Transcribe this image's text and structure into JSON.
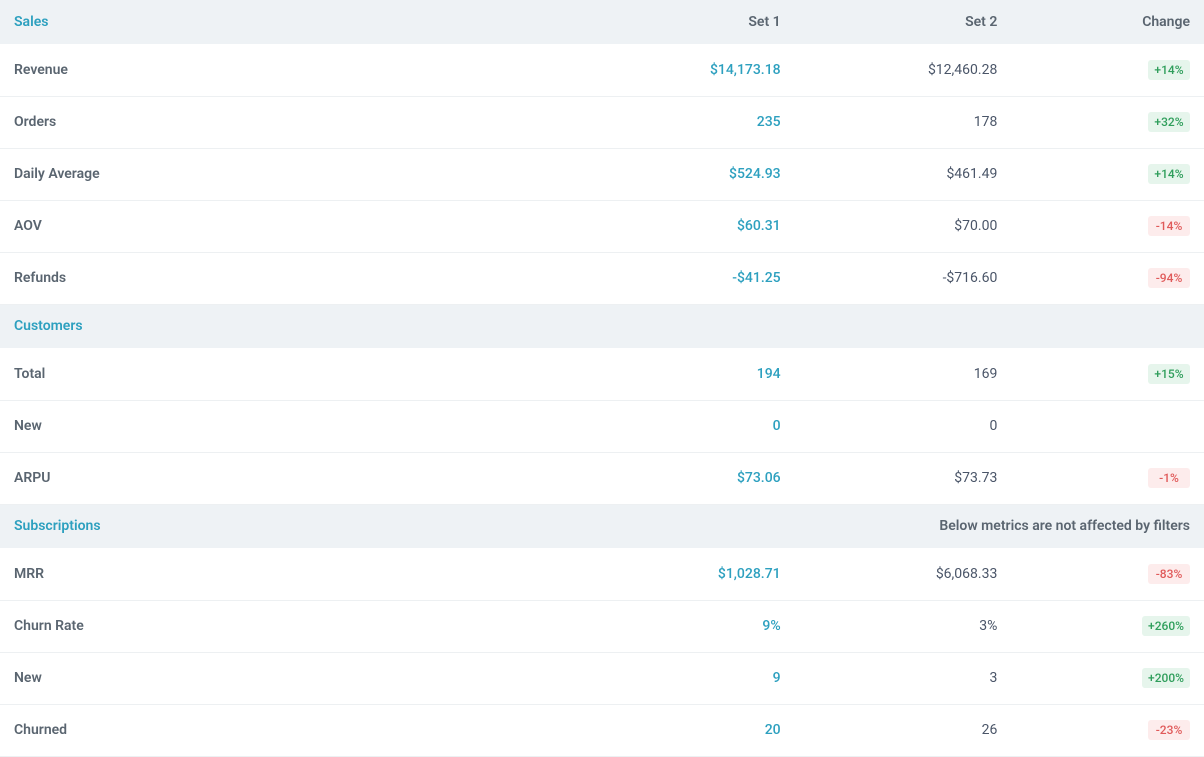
{
  "columns": {
    "set1": "Set 1",
    "set2": "Set 2",
    "change": "Change"
  },
  "sections": {
    "sales": {
      "title": "Sales",
      "rows": {
        "revenue": {
          "label": "Revenue",
          "set1": "$14,173.18",
          "set2": "$12,460.28",
          "change": "+14%",
          "dir": "pos"
        },
        "orders": {
          "label": "Orders",
          "set1": "235",
          "set2": "178",
          "change": "+32%",
          "dir": "pos"
        },
        "daily_avg": {
          "label": "Daily Average",
          "set1": "$524.93",
          "set2": "$461.49",
          "change": "+14%",
          "dir": "pos"
        },
        "aov": {
          "label": "AOV",
          "set1": "$60.31",
          "set2": "$70.00",
          "change": "-14%",
          "dir": "neg"
        },
        "refunds": {
          "label": "Refunds",
          "set1": "-$41.25",
          "set2": "-$716.60",
          "change": "-94%",
          "dir": "neg"
        }
      }
    },
    "customers": {
      "title": "Customers",
      "rows": {
        "total": {
          "label": "Total",
          "set1": "194",
          "set2": "169",
          "change": "+15%",
          "dir": "pos"
        },
        "new": {
          "label": "New",
          "set1": "0",
          "set2": "0",
          "change": "",
          "dir": ""
        },
        "arpu": {
          "label": "ARPU",
          "set1": "$73.06",
          "set2": "$73.73",
          "change": "-1%",
          "dir": "neg"
        }
      }
    },
    "subscriptions": {
      "title": "Subscriptions",
      "note": "Below metrics are not affected by filters",
      "rows": {
        "mrr": {
          "label": "MRR",
          "set1": "$1,028.71",
          "set2": "$6,068.33",
          "change": "-83%",
          "dir": "neg"
        },
        "churn_rate": {
          "label": "Churn Rate",
          "set1": "9%",
          "set2": "3%",
          "change": "+260%",
          "dir": "pos"
        },
        "new": {
          "label": "New",
          "set1": "9",
          "set2": "3",
          "change": "+200%",
          "dir": "pos"
        },
        "churned": {
          "label": "Churned",
          "set1": "20",
          "set2": "26",
          "change": "-23%",
          "dir": "neg"
        }
      }
    }
  }
}
